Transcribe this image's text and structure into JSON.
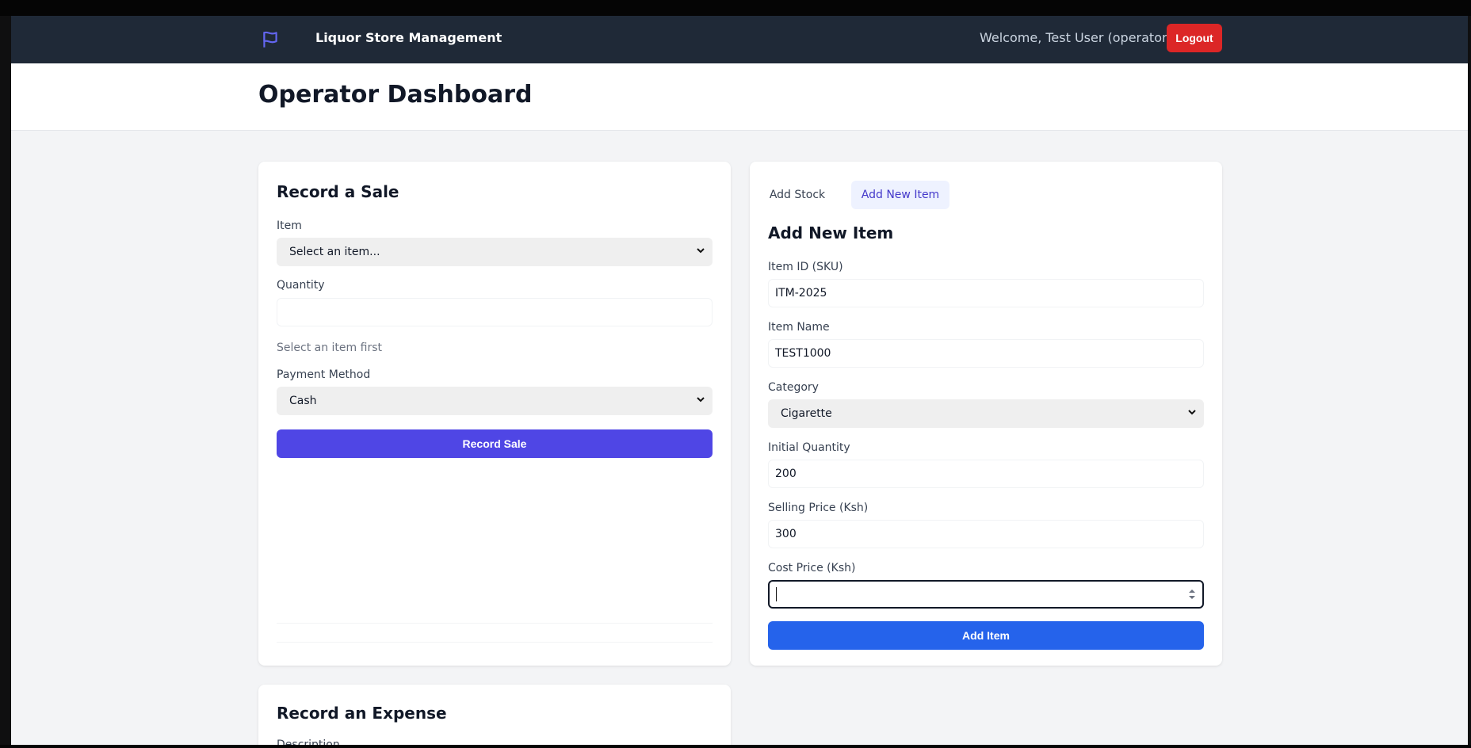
{
  "navbar": {
    "title": "Liquor Store Management",
    "welcome": "Welcome, Test User (operator)",
    "logout_label": "Logout",
    "brand_icon": "flag-icon"
  },
  "header": {
    "title": "Operator Dashboard"
  },
  "sale": {
    "title": "Record a Sale",
    "item_label": "Item",
    "item_value": "Select an item...",
    "quantity_label": "Quantity",
    "quantity_value": "",
    "quantity_hint": "Select an item first",
    "payment_label": "Payment Method",
    "payment_value": "Cash",
    "submit_label": "Record Sale"
  },
  "add_item": {
    "tabs": [
      {
        "label": "Add Stock",
        "active": false
      },
      {
        "label": "Add New Item",
        "active": true
      }
    ],
    "title": "Add New Item",
    "sku_label": "Item ID (SKU)",
    "sku_value": "ITM-2025",
    "name_label": "Item Name",
    "name_value": "TEST1000",
    "category_label": "Category",
    "category_value": "Cigarette",
    "qty_label": "Initial Quantity",
    "qty_value": "200",
    "sell_label": "Selling Price (Ksh)",
    "sell_value": "300",
    "cost_label": "Cost Price (Ksh)",
    "cost_value": "",
    "submit_label": "Add Item"
  },
  "expense": {
    "title": "Record an Expense",
    "description_label": "Description"
  },
  "colors": {
    "navbar_bg": "#1f2937",
    "primary_indigo": "#4f46e5",
    "primary_blue": "#2563eb",
    "logout_red": "#dc2626",
    "page_bg": "#f3f4f6"
  }
}
